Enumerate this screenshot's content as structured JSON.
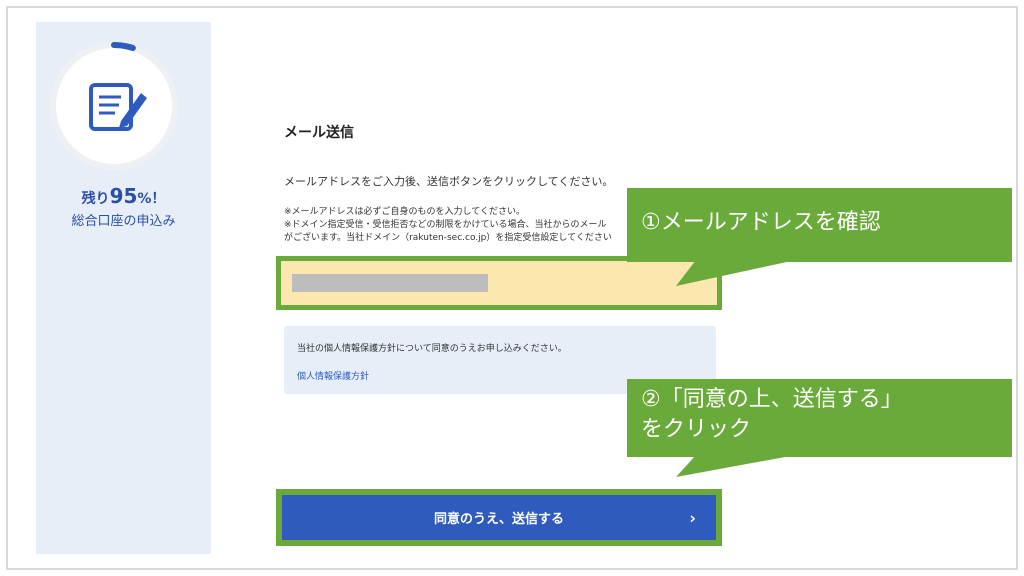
{
  "sidebar": {
    "progress_prefix": "残り",
    "progress_value": "95",
    "progress_suffix": "%！",
    "progress_remaining_fraction": 0.95,
    "subtitle": "総合口座の申込み",
    "icon": "document-edit-icon"
  },
  "form": {
    "title": "メール送信",
    "instruction": "メールアドレスをご入力後、送信ボタンをクリックしてください。",
    "note1": "※メールアドレスは必ずご自身のものを入力してください。",
    "note2": "※ドメイン指定受信・受信拒否などの制限をかけている場合、当社からのメール",
    "note3": "がございます。当社ドメイン（rakuten-sec.co.jp）を指定受信設定してください",
    "email_value": ""
  },
  "privacy": {
    "text": "当社の個人情報保護方針について同意のうえお申し込みください。",
    "link_label": "個人情報保護方針"
  },
  "submit": {
    "label": "同意のうえ、送信する",
    "chevron": "›"
  },
  "callouts": {
    "step1": "①メールアドレスを確認",
    "step2_line1": "②「同意の上、送信する」",
    "step2_line2": "をクリック"
  },
  "colors": {
    "accent_blue": "#2e5bbd",
    "callout_green": "#6aaa3a",
    "input_highlight": "#fde7b0",
    "sidebar_bg": "#e8eef8"
  }
}
